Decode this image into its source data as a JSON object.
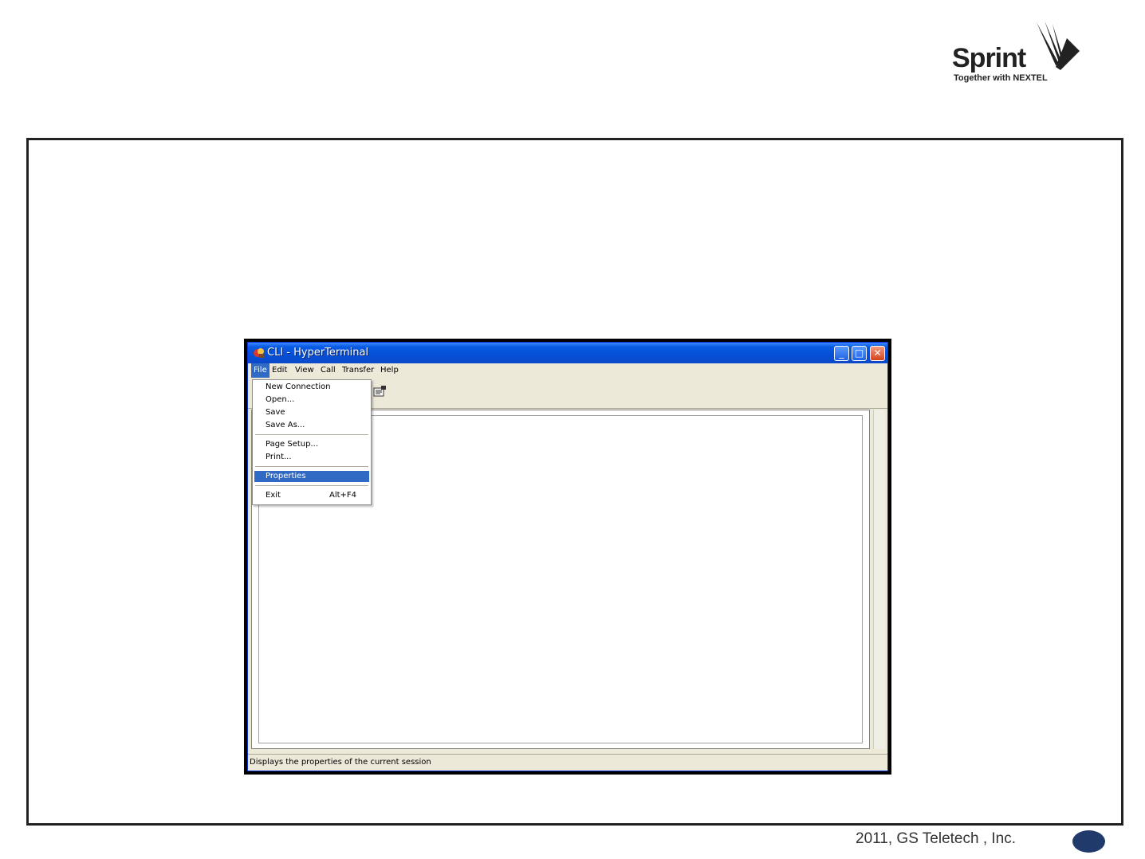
{
  "logo": {
    "word": "Sprint",
    "tagline": "Together with NEXTEL"
  },
  "window": {
    "title": "CLI - HyperTerminal",
    "app_icon": "hyperterminal-icon",
    "controls": {
      "minimize": "minimize-icon",
      "maximize": "maximize-icon",
      "close": "close-icon"
    }
  },
  "menubar": {
    "file": "File",
    "edit": "Edit",
    "view": "View",
    "call": "Call",
    "transfer": "Transfer",
    "help": "Help"
  },
  "toolbar": {
    "properties_icon": "properties-icon"
  },
  "file_menu": {
    "new_connection": "New Connection",
    "open": "Open...",
    "save": "Save",
    "save_as": "Save As...",
    "page_setup": "Page Setup...",
    "print": "Print...",
    "properties": "Properties",
    "exit": "Exit",
    "exit_shortcut": "Alt+F4"
  },
  "status": {
    "text": "Displays the properties of the current session"
  },
  "footer": {
    "text": "2011, GS Teletech , Inc."
  },
  "colors": {
    "selection": "#316ac5",
    "titlebar": "#0550d6",
    "badge": "#1f3a6b"
  }
}
